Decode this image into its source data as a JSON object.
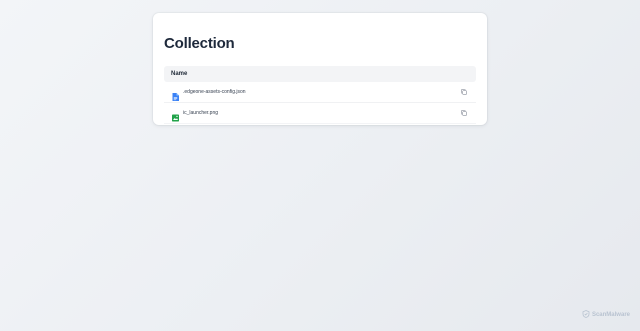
{
  "page": {
    "title": "Collection"
  },
  "table": {
    "header_name": "Name",
    "rows": [
      {
        "name": ".edgeone-assets-config.json",
        "icon": "document-icon",
        "color": "#3b82f6"
      },
      {
        "name": "ic_launcher.png",
        "icon": "image-icon",
        "color": "#22a34a"
      }
    ]
  },
  "watermark": {
    "text": "ScanMalware"
  },
  "colors": {
    "background": "#eceff3",
    "card": "#ffffff",
    "header_bg": "#f3f4f6",
    "doc_icon": "#3b82f6",
    "image_icon": "#22a34a",
    "title_text": "#1e293b"
  }
}
